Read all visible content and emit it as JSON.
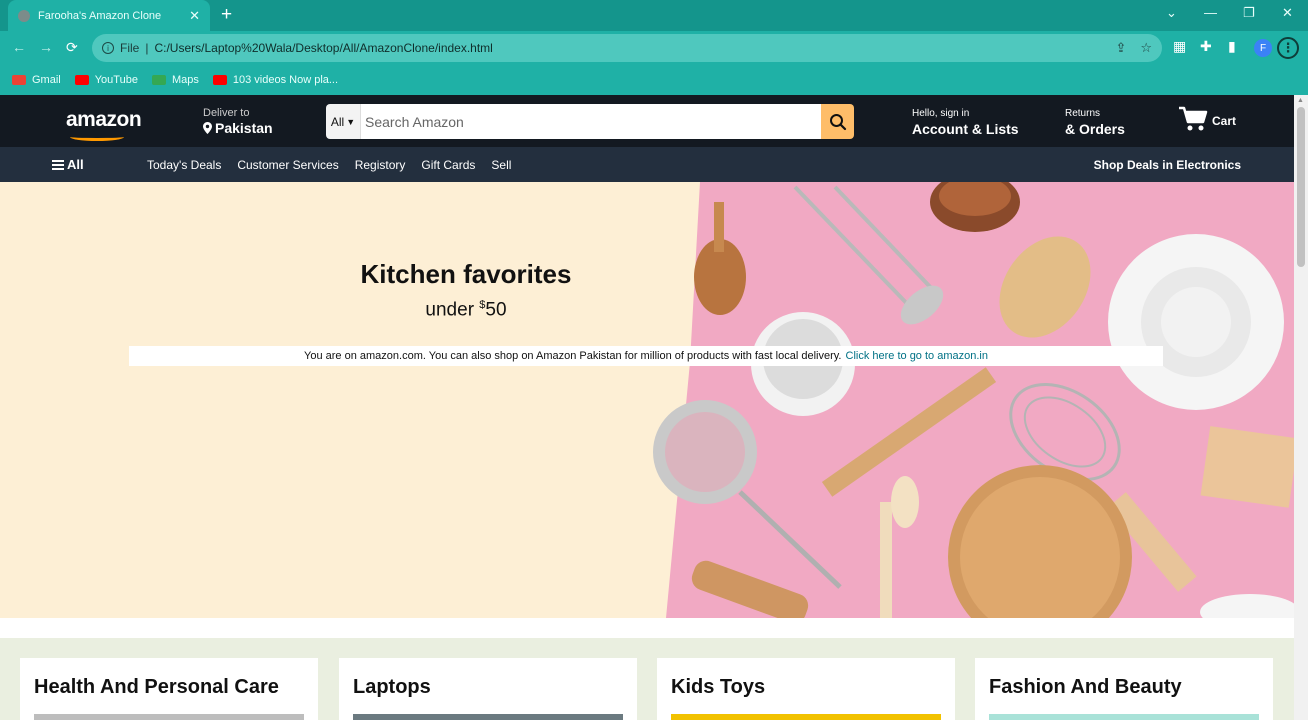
{
  "browser": {
    "tab_title": "Farooha's Amazon Clone",
    "tab_close": "✕",
    "new_tab": "+",
    "window_controls": {
      "dropdown": "⌄",
      "minimize": "—",
      "restore": "❐",
      "close": "✕"
    },
    "nav": {
      "back": "←",
      "forward": "→",
      "reload": "⟳"
    },
    "address": {
      "scheme_label": "File",
      "separator": "|",
      "url": "C:/Users/Laptop%20Wala/Desktop/All/AmazonClone/index.html"
    },
    "profile_initial": "F",
    "bookmarks": [
      {
        "label": "Gmail",
        "color": "#ea4335"
      },
      {
        "label": "YouTube",
        "color": "#ff0000"
      },
      {
        "label": "Maps",
        "color": "#34a853"
      },
      {
        "label": "103 videos Now pla...",
        "color": "#ff0000"
      }
    ]
  },
  "amazon": {
    "logo": "amazon",
    "deliver": {
      "line1": "Deliver to",
      "line2": "Pakistan"
    },
    "search": {
      "category": "All",
      "placeholder": "Search Amazon"
    },
    "account": {
      "line1": "Hello, sign in",
      "line2": "Account & Lists"
    },
    "returns": {
      "line1": "Returns",
      "line2": "& Orders"
    },
    "cart_label": "Cart",
    "all_menu": "All",
    "nav_links": [
      "Today's Deals",
      "Customer Services",
      "Registory",
      "Gift Cards",
      "Sell"
    ],
    "shop_deals": "Shop Deals in Electronics",
    "hero": {
      "title": "Kitchen favorites",
      "subtitle_prefix": "under ",
      "subtitle_sup": "$",
      "subtitle_value": "50"
    },
    "notice": {
      "text": "You are on amazon.com. You can also shop on Amazon Pakistan for million of products with fast local delivery.",
      "link": "Click here to go to amazon.in"
    },
    "cards": [
      {
        "title": "Health And Personal Care",
        "thumb_color": "#bdbdbd"
      },
      {
        "title": "Laptops",
        "thumb_color": "#6b7a80"
      },
      {
        "title": "Kids Toys",
        "thumb_color": "#f2c200"
      },
      {
        "title": "Fashion And Beauty",
        "thumb_color": "#a9e2d8"
      }
    ]
  }
}
